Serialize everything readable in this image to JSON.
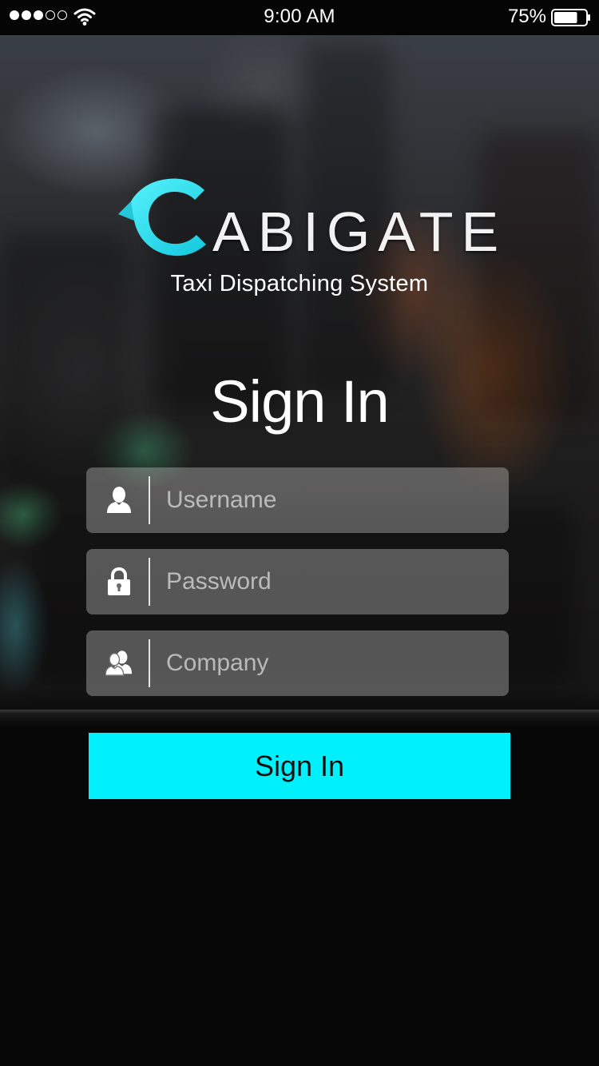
{
  "status_bar": {
    "time": "9:00 AM",
    "battery_percent": "75%",
    "battery_level": 0.75,
    "signal_bars_filled": 3,
    "signal_bars_total": 5
  },
  "brand": {
    "logo_text": "ABIGATE",
    "logo_letter": "C",
    "tagline": "Taxi Dispatching System",
    "accent_color": "#1ee3ef"
  },
  "form": {
    "title": "Sign In",
    "fields": [
      {
        "id": "username",
        "icon": "user-icon",
        "placeholder": "Username",
        "value": ""
      },
      {
        "id": "password",
        "icon": "lock-icon",
        "placeholder": "Password",
        "value": ""
      },
      {
        "id": "company",
        "icon": "users-icon",
        "placeholder": "Company",
        "value": ""
      }
    ],
    "submit_label": "Sign In",
    "submit_color": "#00f0fc"
  }
}
